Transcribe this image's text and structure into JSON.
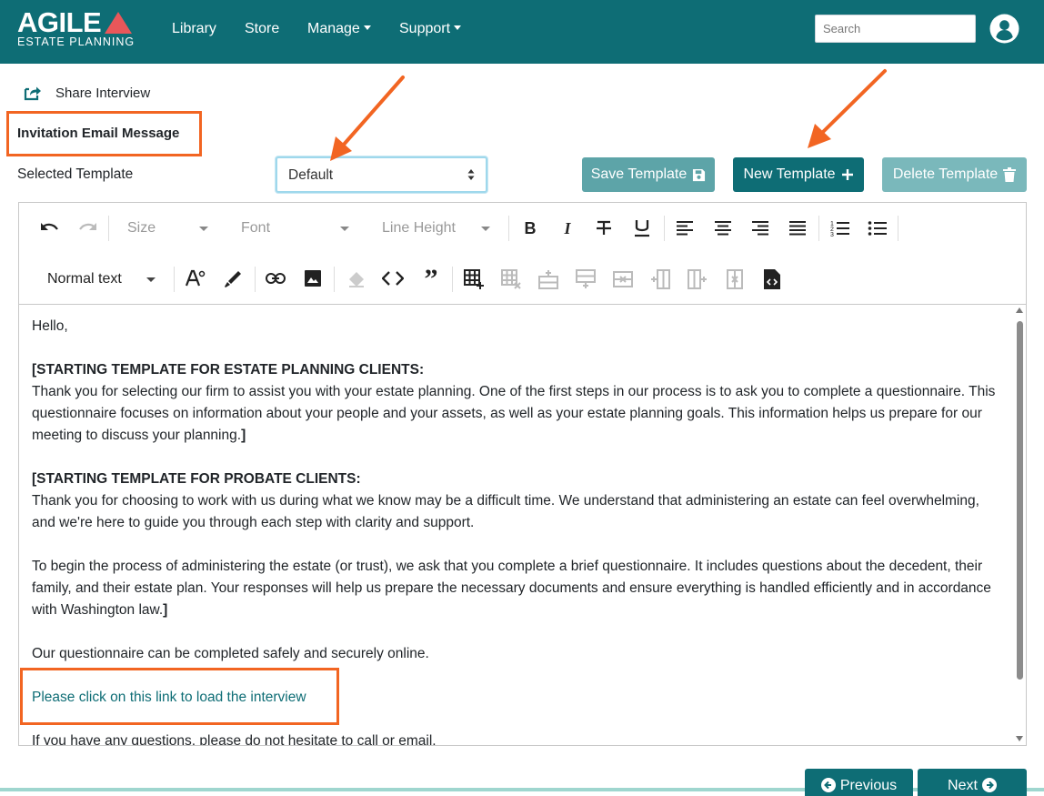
{
  "brand": {
    "name": "AGILE",
    "subtitle": "ESTATE PLANNING"
  },
  "nav": {
    "library": "Library",
    "store": "Store",
    "manage": "Manage",
    "support": "Support",
    "search_placeholder": "Search"
  },
  "share": {
    "label": "Share Interview"
  },
  "section": {
    "title": "Invitation Email Message"
  },
  "template": {
    "label": "Selected Template",
    "selected": "Default",
    "save_label": "Save Template",
    "new_label": "New Template",
    "delete_label": "Delete Template"
  },
  "toolbar": {
    "size_label": "Size",
    "font_label": "Font",
    "line_height_label": "Line Height",
    "block_format": "Normal text"
  },
  "content": {
    "greeting": "Hello,",
    "estate_heading": "[STARTING TEMPLATE FOR ESTATE PLANNING CLIENTS:",
    "estate_body": "Thank you for selecting our firm to assist you with your estate planning. One of the first steps in our process is to ask you to complete a questionnaire. This questionnaire focuses on information about your people and your assets, as well as your estate planning goals. This information helps us prepare for our meeting to discuss your planning.",
    "bracket_close": "]",
    "probate_heading": "[STARTING TEMPLATE FOR PROBATE CLIENTS:",
    "probate_body1": "Thank you for choosing to work with us during what we know may be a difficult time. We understand that administering an estate can feel overwhelming, and we're here to guide you through each step with clarity and support.",
    "probate_body2": "To begin the process of administering the estate (or trust), we ask that you complete a brief questionnaire. It includes questions about the decedent, their family, and their estate plan. Your responses will help us prepare the necessary documents and ensure everything is handled efficiently and in accordance with Washington law.",
    "secure_line": "Our questionnaire can be completed safely and securely online.",
    "link_text": "Please click on this link to load the interview",
    "questions_line": "If you have any questions, please do not hesitate to call or email."
  },
  "footer": {
    "previous_label": "Previous",
    "next_label": "Next"
  },
  "colors": {
    "brand_teal": "#0e6d75",
    "highlight_orange": "#f26522",
    "logo_red": "#e9575a"
  },
  "icons": [
    "share-icon",
    "avatar-icon",
    "save-icon",
    "plus-icon",
    "trash-icon",
    "undo-icon",
    "redo-icon",
    "bold-icon",
    "italic-icon",
    "strikethrough-icon",
    "underline-icon",
    "align-left-icon",
    "align-center-icon",
    "align-right-icon",
    "align-justify-icon",
    "ordered-list-icon",
    "unordered-list-icon",
    "font-color-icon",
    "highlight-icon",
    "link-icon",
    "image-icon",
    "eraser-icon",
    "code-icon",
    "quote-icon",
    "table-icon",
    "source-code-icon"
  ]
}
